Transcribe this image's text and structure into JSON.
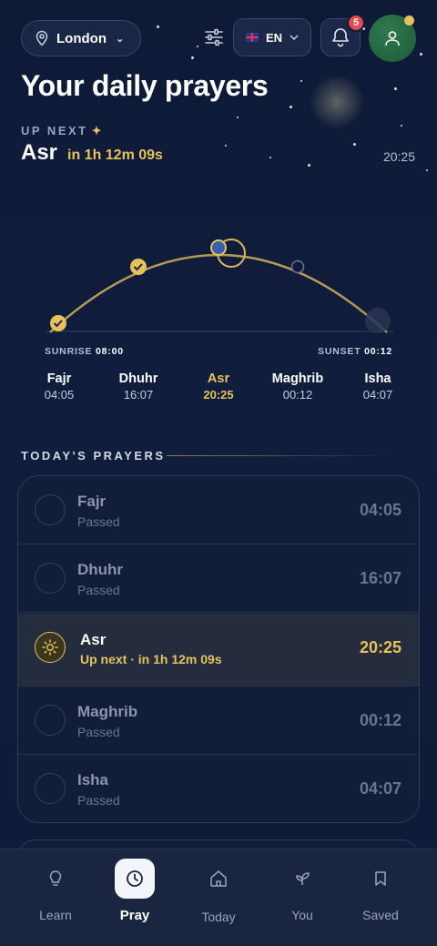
{
  "topbar": {
    "location": "London",
    "language": "EN",
    "notification_count": "5"
  },
  "title": "Your daily prayers",
  "up_next": {
    "label": "UP NEXT",
    "name": "Asr",
    "countdown": "in 1h 12m 09s",
    "time": "20:25"
  },
  "arc": {
    "sunrise_label": "SUNRISE",
    "sunrise_time": "08:00",
    "sunset_label": "SUNSET",
    "sunset_time": "00:12",
    "prayers": [
      {
        "name": "Fajr",
        "time": "04:05"
      },
      {
        "name": "Dhuhr",
        "time": "16:07"
      },
      {
        "name": "Asr",
        "time": "20:25"
      },
      {
        "name": "Maghrib",
        "time": "00:12"
      },
      {
        "name": "Isha",
        "time": "04:07"
      }
    ]
  },
  "todays": {
    "heading": "TODAY'S PRAYERS",
    "rows": [
      {
        "name": "Fajr",
        "status": "Passed",
        "time": "04:05"
      },
      {
        "name": "Dhuhr",
        "status": "Passed",
        "time": "16:07"
      },
      {
        "name": "Asr",
        "status": "Up next · in 1h 12m 09s",
        "time": "20:25"
      },
      {
        "name": "Maghrib",
        "status": "Passed",
        "time": "00:12"
      },
      {
        "name": "Isha",
        "status": "Passed",
        "time": "04:07"
      }
    ]
  },
  "nav": {
    "items": [
      {
        "label": "Learn",
        "icon": "lightbulb-icon"
      },
      {
        "label": "Pray",
        "icon": "clock-icon"
      },
      {
        "label": "Today",
        "icon": "home-icon"
      },
      {
        "label": "You",
        "icon": "sprout-icon"
      },
      {
        "label": "Saved",
        "icon": "bookmark-icon"
      }
    ]
  },
  "colors": {
    "accent": "#e6c25c",
    "background": "#0e1a36",
    "badge": "#e5484d"
  }
}
